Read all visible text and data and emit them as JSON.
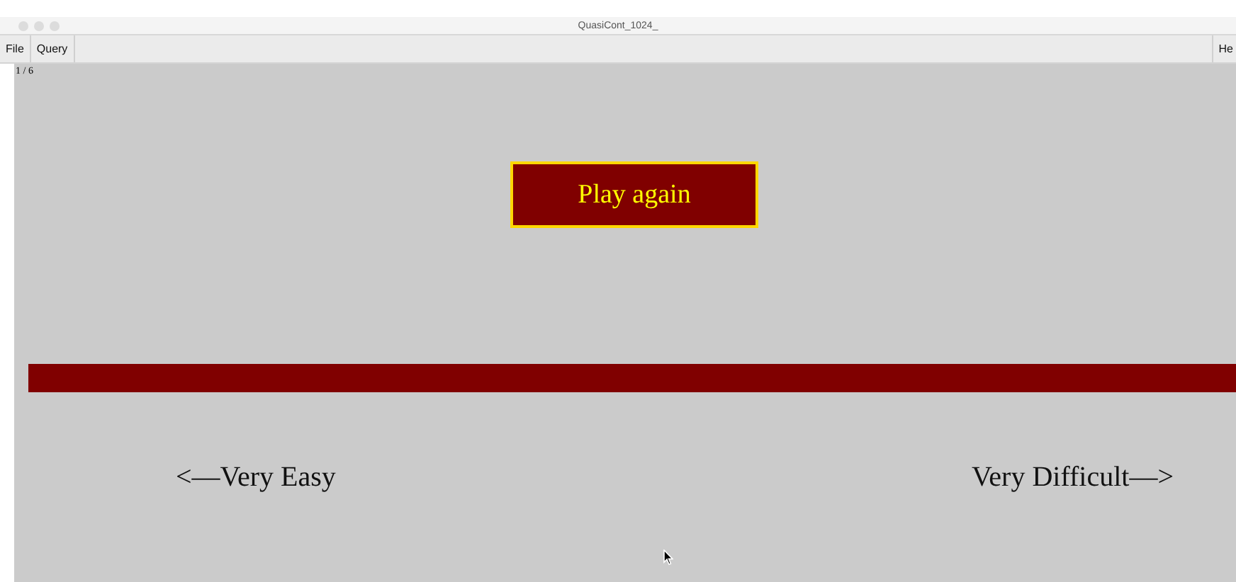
{
  "window": {
    "title": "QuasiCont_1024_"
  },
  "menu": [
    "File",
    "Query"
  ],
  "menu_right": "He",
  "counter": "1 / 6",
  "play_button": "Play again",
  "scale": {
    "left": "<—Very Easy",
    "right": "Very Difficult—>"
  }
}
